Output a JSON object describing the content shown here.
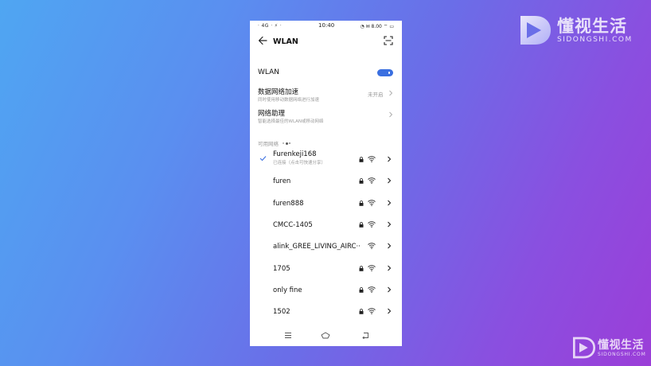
{
  "watermark": {
    "primary_text": "懂视生活",
    "primary_sub": "SIDONGSHI.COM",
    "secondary_text": "懂视生活",
    "secondary_sub": "SIDONGSHI.COM"
  },
  "status_bar": {
    "left_icons_text": "ᐧ 4G ᐧ ⚡ ᐧ",
    "time": "10:40",
    "right_text": "◔ ✉ 8.00 ⌔ ▭"
  },
  "header": {
    "title": "WLAN",
    "back_icon": "back-arrow-icon",
    "scan_icon": "scan-icon"
  },
  "wlan_toggle": {
    "label": "WLAN",
    "state": "on",
    "color": "#3a6fe0"
  },
  "settings": [
    {
      "title": "数据网络加速",
      "subtitle": "同时使用移动数据网络进行加速",
      "value": "未开启"
    },
    {
      "title": "网络助理",
      "subtitle": "智能选择最佳的WLAN或移动网络",
      "value": ""
    }
  ],
  "section_label": "可用网络",
  "networks": [
    {
      "name": "Furenkeji168",
      "status": "已连接（点击可快速分享）",
      "connected": true,
      "locked": true
    },
    {
      "name": "furen",
      "status": "",
      "connected": false,
      "locked": true
    },
    {
      "name": "furen888",
      "status": "",
      "connected": false,
      "locked": true
    },
    {
      "name": "CMCC-1405",
      "status": "",
      "connected": false,
      "locked": true
    },
    {
      "name": "alink_GREE_LIVING_AIRC··",
      "status": "",
      "connected": false,
      "locked": false
    },
    {
      "name": "1705",
      "status": "",
      "connected": false,
      "locked": true
    },
    {
      "name": "only fine",
      "status": "",
      "connected": false,
      "locked": true
    },
    {
      "name": "1502",
      "status": "",
      "connected": false,
      "locked": true
    }
  ],
  "navbar": {
    "menu_icon": "menu-icon",
    "home_icon": "home-icon",
    "back_icon": "nav-back-icon"
  }
}
